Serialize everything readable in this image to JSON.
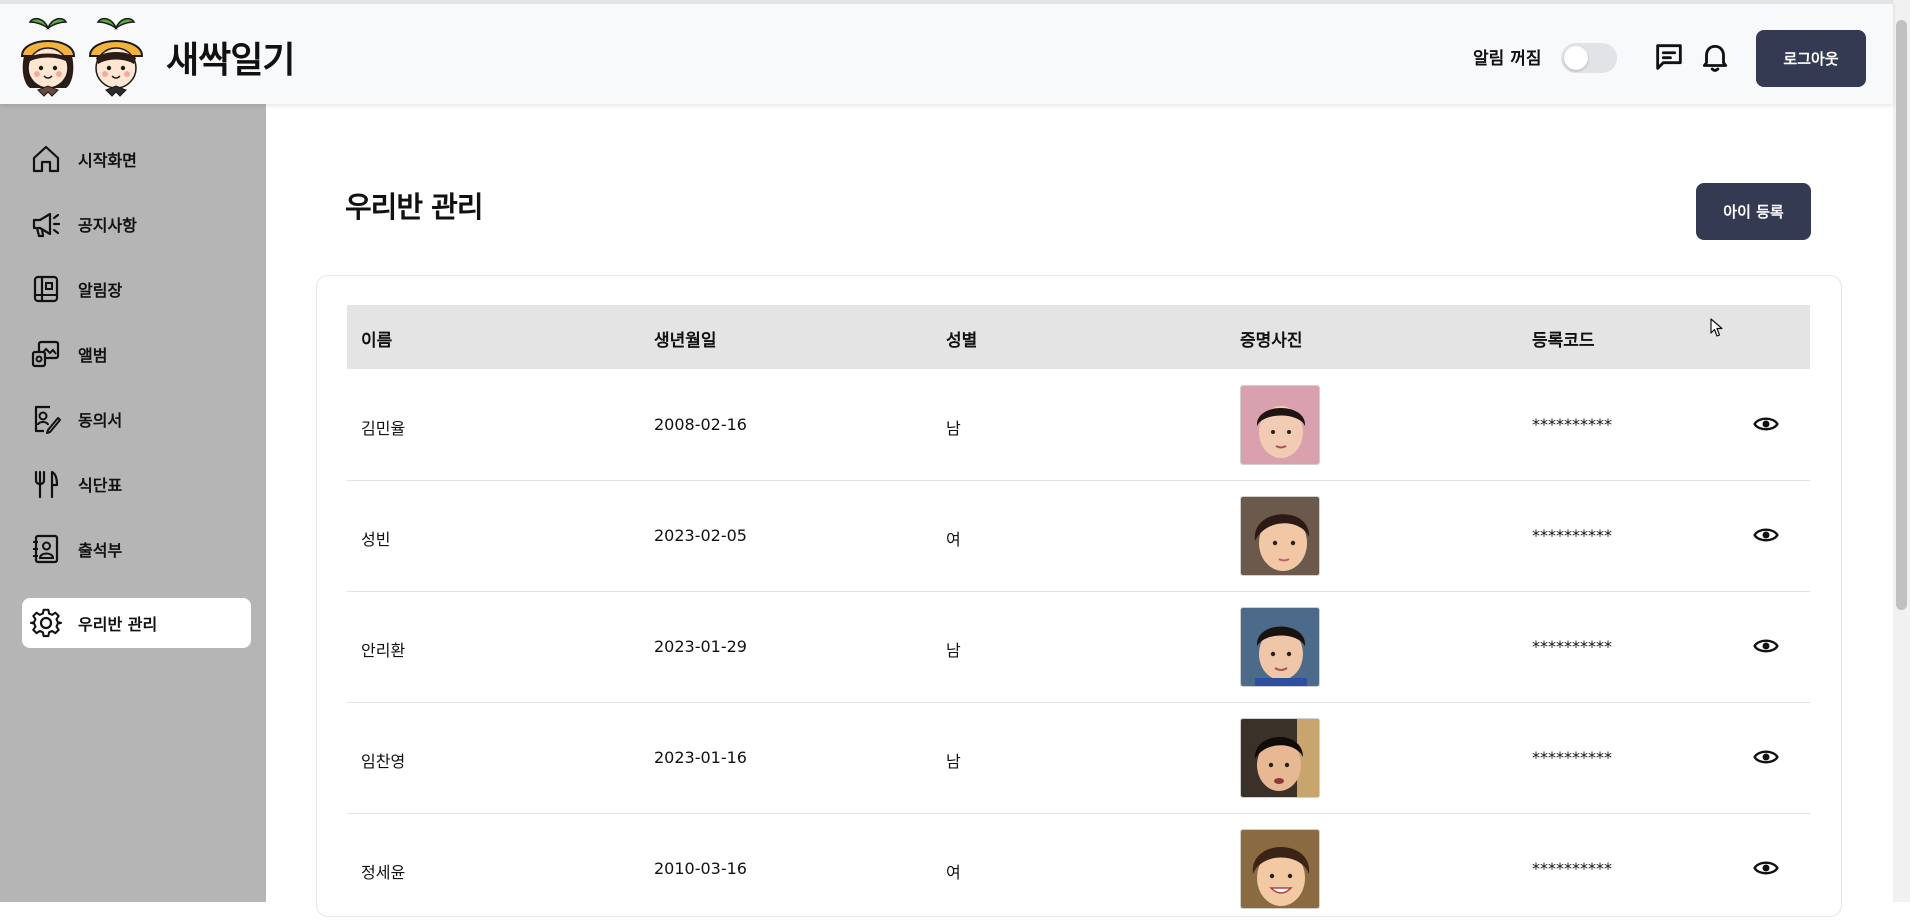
{
  "header": {
    "brand": "새싹일기",
    "notif_label": "알림 꺼짐",
    "notif_on": false,
    "chat_icon": "chat-icon",
    "bell_icon": "bell-icon",
    "logout_label": "로그아웃"
  },
  "sidebar": {
    "items": [
      {
        "label": "시작화면",
        "icon": "home-icon"
      },
      {
        "label": "공지사항",
        "icon": "megaphone-icon"
      },
      {
        "label": "알림장",
        "icon": "notebook-icon"
      },
      {
        "label": "앨범",
        "icon": "album-icon"
      },
      {
        "label": "동의서",
        "icon": "consent-icon"
      },
      {
        "label": "식단표",
        "icon": "fork-knife-icon"
      },
      {
        "label": "출석부",
        "icon": "attendance-icon"
      },
      {
        "label": "우리반 관리",
        "icon": "gear-icon",
        "active": true
      }
    ]
  },
  "main": {
    "title": "우리반 관리",
    "add_label": "아이 등록",
    "table": {
      "headers": [
        "이름",
        "생년월일",
        "성별",
        "증명사진",
        "등록코드"
      ],
      "rows": [
        {
          "name": "김민율",
          "birth": "2008-02-16",
          "gender": "남",
          "code": "**********"
        },
        {
          "name": "성빈",
          "birth": "2023-02-05",
          "gender": "여",
          "code": "**********"
        },
        {
          "name": "안리환",
          "birth": "2023-01-29",
          "gender": "남",
          "code": "**********"
        },
        {
          "name": "임찬영",
          "birth": "2023-01-16",
          "gender": "남",
          "code": "**********"
        },
        {
          "name": "정세윤",
          "birth": "2010-03-16",
          "gender": "여",
          "code": "**********"
        }
      ]
    }
  },
  "colors": {
    "primary_button": "#333a52",
    "sidebar_bg": "#b5b5b5",
    "table_header_bg": "#e4e4e4"
  }
}
